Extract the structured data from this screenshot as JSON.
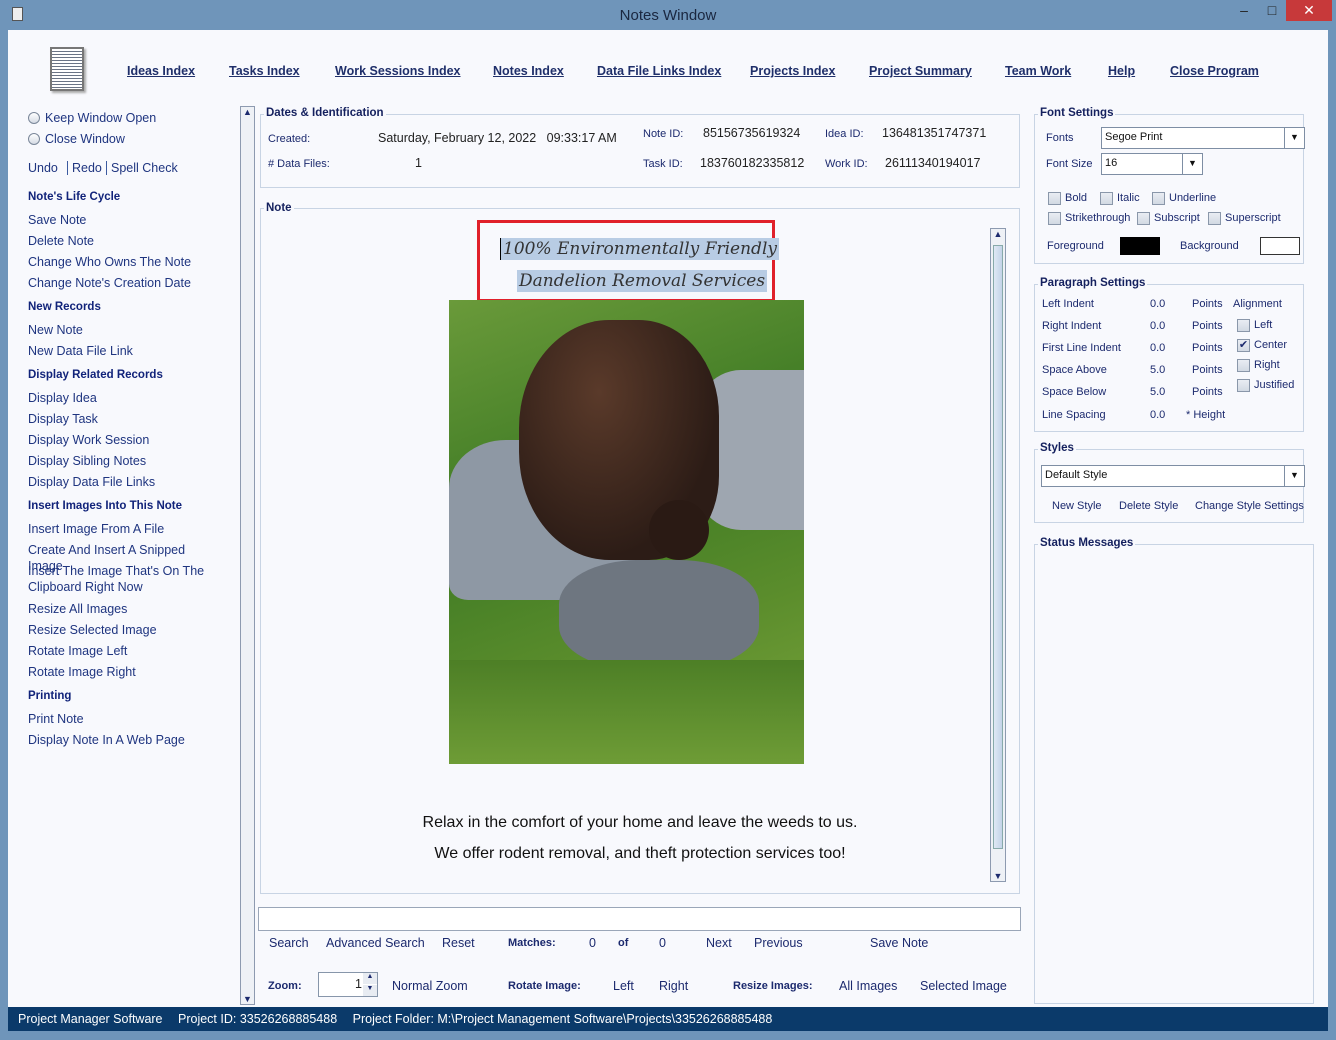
{
  "window": {
    "title": "Notes Window",
    "min": "–",
    "max": "□",
    "close": "✕"
  },
  "nav": [
    "Ideas Index",
    "Tasks Index",
    "Work Sessions Index",
    "Notes Index",
    "Data File Links Index",
    "Projects Index",
    "Project Summary",
    "Team Work",
    "Help",
    "Close Program"
  ],
  "sidebar": {
    "radios": [
      "Keep Window Open",
      "Close Window"
    ],
    "edit": [
      "Undo",
      "Redo",
      "Spell Check"
    ],
    "sections": [
      {
        "title": "Note's Life Cycle",
        "items": [
          "Save Note",
          "Delete Note",
          "Change Who Owns The Note",
          "Change Note's Creation Date"
        ]
      },
      {
        "title": "New Records",
        "items": [
          "New Note",
          "New Data File Link"
        ]
      },
      {
        "title": "Display Related Records",
        "items": [
          "Display Idea",
          "Display Task",
          "Display Work Session",
          "Display Sibling Notes",
          "Display Data File Links"
        ]
      },
      {
        "title": "Insert Images Into This Note",
        "items": [
          "Insert Image From A File",
          "Create And Insert A Snipped Image",
          "Insert The Image That's On The Clipboard Right Now",
          "Resize All Images",
          "Resize Selected Image",
          "Rotate Image Left",
          "Rotate Image Right"
        ]
      },
      {
        "title": "Printing",
        "items": [
          "Print Note",
          "Display Note In A Web Page"
        ]
      }
    ]
  },
  "dates": {
    "legend": "Dates & Identification",
    "created_label": "Created:",
    "created": "Saturday, February 12, 2022   09:33:17 AM",
    "datafiles_label": "# Data Files:",
    "datafiles": "1",
    "note_id_label": "Note ID:",
    "note_id": "85156735619324",
    "idea_id_label": "Idea ID:",
    "idea_id": "136481351747371",
    "task_id_label": "Task ID:",
    "task_id": "183760182335812",
    "work_id_label": "Work ID:",
    "work_id": "26111340194017"
  },
  "note": {
    "legend": "Note",
    "heading1": "100% Environmentally Friendly",
    "heading2": "Dandelion Removal Services",
    "line1": "Relax in the comfort of your home and leave the weeds to us.",
    "line2": "We offer rodent removal, and theft protection services too!"
  },
  "search": {
    "value": "",
    "search": "Search",
    "advanced": "Advanced Search",
    "reset": "Reset",
    "matches_label": "Matches:",
    "matches": "0",
    "of": "of",
    "total": "0",
    "next": "Next",
    "previous": "Previous",
    "save": "Save Note"
  },
  "zoombar": {
    "zoom_label": "Zoom:",
    "zoom": "1",
    "normal": "Normal Zoom",
    "rotate_label": "Rotate Image:",
    "left": "Left",
    "right": "Right",
    "resize_label": "Resize Images:",
    "all": "All Images",
    "selected": "Selected Image"
  },
  "font": {
    "legend": "Font Settings",
    "fonts_label": "Fonts",
    "font": "Segoe Print",
    "size_label": "Font Size",
    "size": "16",
    "bold": "Bold",
    "italic": "Italic",
    "underline": "Underline",
    "strike": "Strikethrough",
    "sub": "Subscript",
    "sup": "Superscript",
    "fg": "Foreground",
    "bg": "Background",
    "fg_color": "#000000",
    "bg_color": "#ffffff"
  },
  "para": {
    "legend": "Paragraph Settings",
    "rows": [
      [
        "Left Indent",
        "0.0",
        "Points"
      ],
      [
        "Right Indent",
        "0.0",
        "Points"
      ],
      [
        "First Line Indent",
        "0.0",
        "Points"
      ],
      [
        "Space Above",
        "5.0",
        "Points"
      ],
      [
        "Space Below",
        "5.0",
        "Points"
      ],
      [
        "Line Spacing",
        "0.0",
        "* Height"
      ]
    ],
    "align_label": "Alignment",
    "align": [
      "Left",
      "Center",
      "Right",
      "Justified"
    ],
    "align_selected": "Center"
  },
  "styles": {
    "legend": "Styles",
    "value": "Default Style",
    "new": "New Style",
    "delete": "Delete Style",
    "change": "Change Style Settings"
  },
  "status_messages": {
    "legend": "Status Messages"
  },
  "statusbar": {
    "app": "Project Manager Software",
    "project_id": "Project ID:  33526268885488",
    "folder": "Project Folder: M:\\Project Management Software\\Projects\\33526268885488"
  }
}
